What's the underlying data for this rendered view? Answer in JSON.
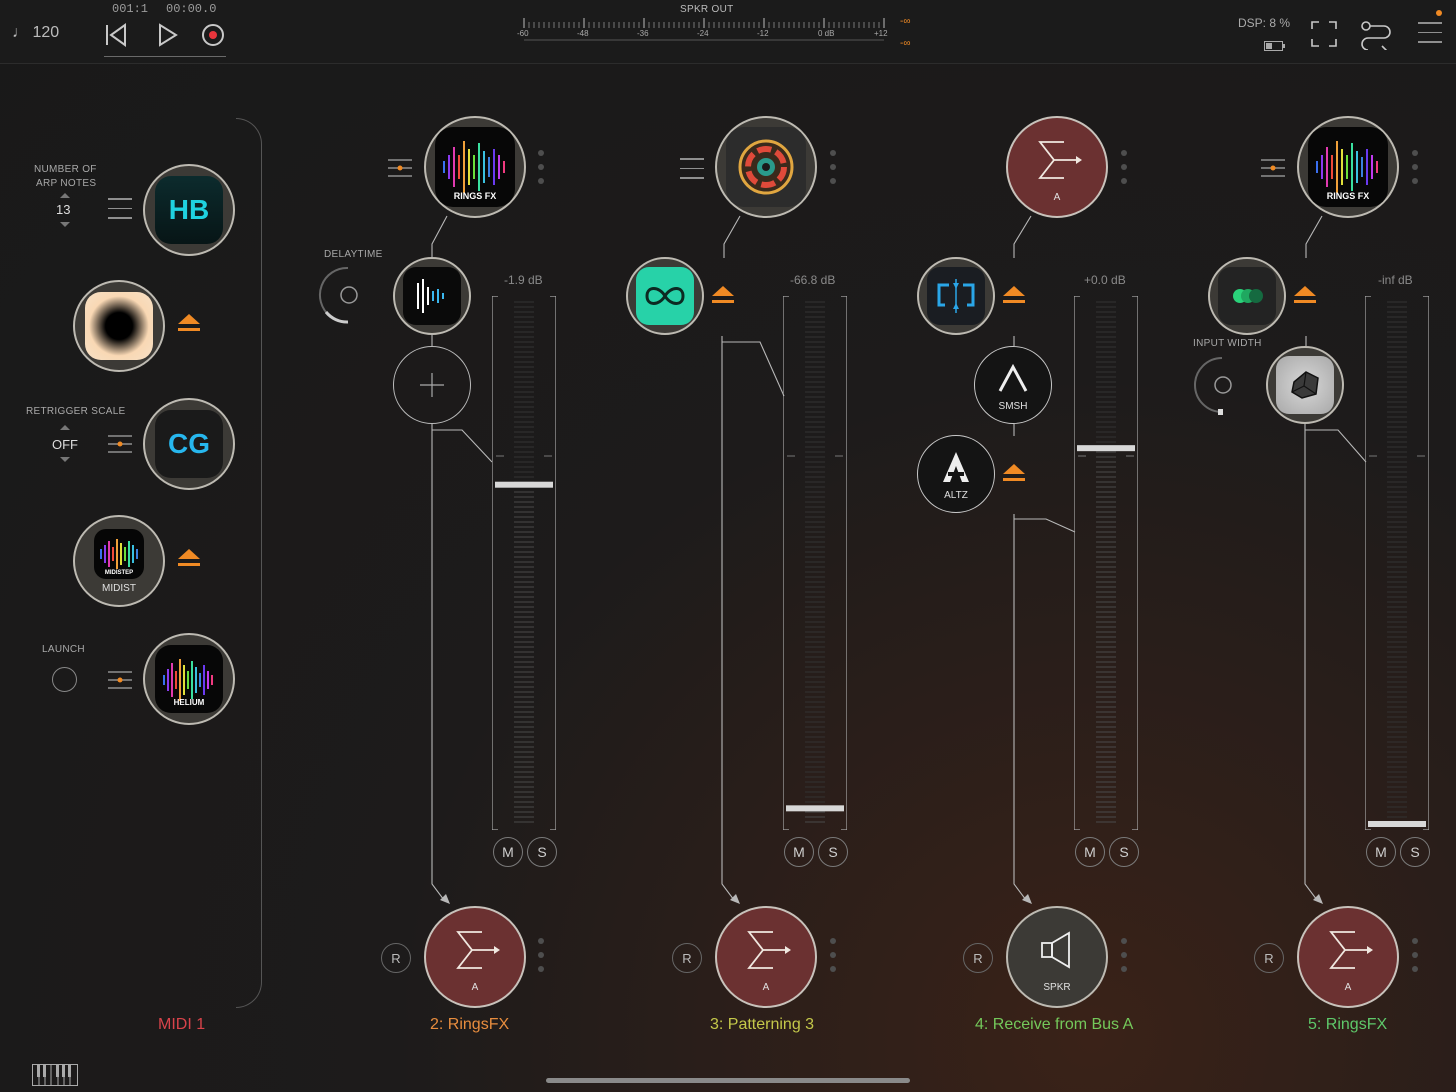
{
  "colors": {
    "accent": "#f08a24",
    "red_node": "#6b3131",
    "midi_label": "#d8434a",
    "ch2_label": "#e88d3e",
    "ch3_label": "#c4c84a",
    "ch4_label": "#74c85a",
    "ch5_label": "#5ec86a"
  },
  "topbar": {
    "tempo": "♩ 120",
    "position": "001:1",
    "time": "00:00.0",
    "meter_title": "SPKR OUT",
    "meter_ticks": [
      "-60",
      "-48",
      "-36",
      "-24",
      "-12",
      "0 dB",
      "+12"
    ],
    "peak_top": "-∞",
    "peak_bottom": "-∞",
    "dsp": "DSP:  8 %",
    "icons": [
      "rewind-icon",
      "play-icon",
      "record-icon",
      "battery-icon",
      "fullscreen-icon",
      "routing-icon",
      "menu-icon"
    ]
  },
  "midi": {
    "label": "MIDI 1",
    "arp_label_1": "NUMBER OF",
    "arp_label_2": "ARP NOTES",
    "arp_value": "13",
    "hb_text": "HB",
    "retrigger_label": "RETRIGGER SCALE",
    "retrigger_value": "OFF",
    "cg_text": "CG",
    "midistep_icon_text": "MIDISTEP",
    "midistep_label": "MIDIST",
    "launch_label": "LAUNCH",
    "helium_text": "HELIUM"
  },
  "channels": [
    {
      "label": "2: RingsFX",
      "top_icon_text": "RINGS FX",
      "param_label": "DELAYTIME",
      "level": "-1.9 dB",
      "fader_fraction": 0.65,
      "mute": "M",
      "solo": "S",
      "record": "R",
      "output": "A"
    },
    {
      "label": "3: Patterning 3",
      "level": "-66.8 dB",
      "fader_fraction": 0.03,
      "mute": "M",
      "solo": "S",
      "record": "R",
      "output": "A"
    },
    {
      "label": "4: Receive from Bus A",
      "top_label": "A",
      "smsh_label": "SMSH",
      "altz_label": "ALTZ",
      "level": "+0.0 dB",
      "fader_fraction": 0.72,
      "mute": "M",
      "solo": "S",
      "record": "R",
      "output": "SPKR"
    },
    {
      "label": "5: RingsFX",
      "top_icon_text": "RINGS FX",
      "param_label": "INPUT WIDTH",
      "level": "-inf dB",
      "fader_fraction": 0.0,
      "mute": "M",
      "solo": "S",
      "record": "R",
      "output": "A"
    }
  ]
}
